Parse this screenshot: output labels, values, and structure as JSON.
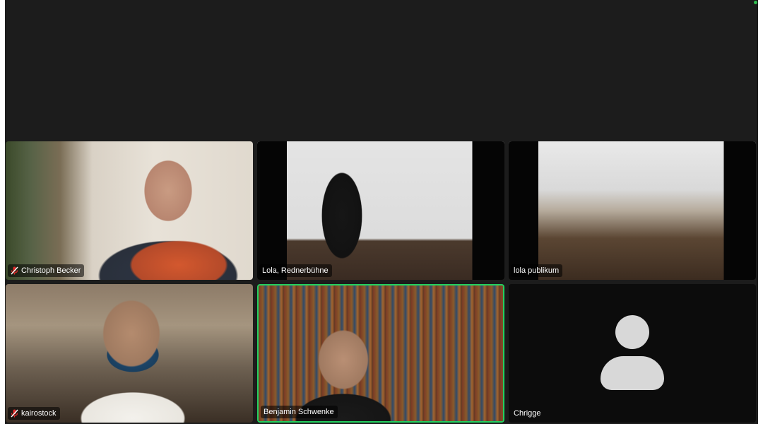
{
  "meeting": {
    "participants": [
      {
        "name": "Christoph Becker",
        "muted": true,
        "active_speaker": false,
        "video": "on"
      },
      {
        "name": "Lola, Rednerbühne",
        "muted": false,
        "active_speaker": false,
        "video": "on"
      },
      {
        "name": "lola publikum",
        "muted": false,
        "active_speaker": false,
        "video": "on"
      },
      {
        "name": "kairostock",
        "muted": true,
        "active_speaker": false,
        "video": "on"
      },
      {
        "name": "Benjamin Schwenke",
        "muted": false,
        "active_speaker": true,
        "video": "on"
      },
      {
        "name": "Chrigge",
        "muted": false,
        "active_speaker": false,
        "video": "off"
      }
    ]
  },
  "colors": {
    "background": "#1c1c1c",
    "active_speaker_border": "#23d160",
    "muted_icon": "#e02828",
    "avatar": "#d8d8d8",
    "status_dot": "#2fbf4f"
  },
  "icons": {
    "muted": "mic-muted-icon",
    "placeholder": "avatar-icon"
  }
}
